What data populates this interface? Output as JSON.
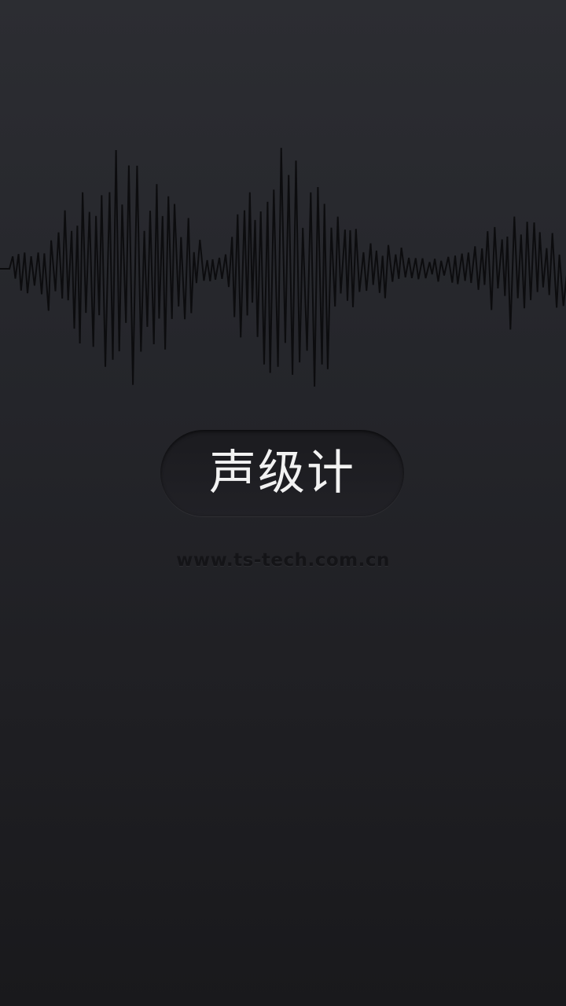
{
  "app": {
    "title": "声级计",
    "website": "www.ts-tech.com.cn"
  },
  "icons": {
    "waveform": "sound-waveform-graphic"
  },
  "colors": {
    "background_top": "#2c2d32",
    "background_bottom": "#19191c",
    "pill": "#1e1e22",
    "title_text": "#f2f2f2",
    "website_text": "#141417",
    "waveform": "#0c0c0e"
  }
}
